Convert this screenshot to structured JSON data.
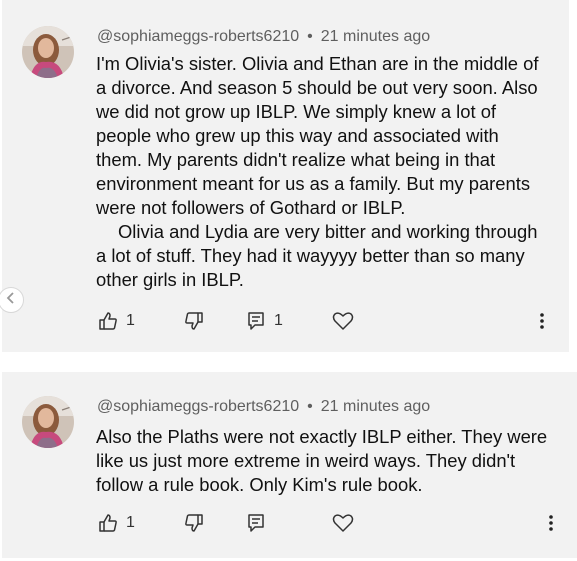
{
  "comments": [
    {
      "username": "@sophiameggs-roberts6210",
      "separator": "•",
      "timestamp": "21 minutes ago",
      "paragraphs": [
        "I'm Olivia's sister. Olivia and Ethan are in the middle of a divorce. And season 5 should be out very soon. Also we did not grow up IBLP. We simply knew a lot of people who grew up this way and associated with them. My parents didn't realize what being in that environment meant for us as a family. But my parents were not followers of Gothard or IBLP.",
        "Olivia and Lydia are very bitter and working through a lot of stuff. They had it wayyyy better than so many other girls in IBLP."
      ],
      "like_count": "1",
      "reply_count": "1"
    },
    {
      "username": "@sophiameggs-roberts6210",
      "separator": "•",
      "timestamp": "21 minutes ago",
      "paragraphs": [
        "Also the Plaths were not exactly IBLP either. They were like us just more extreme in weird ways. They didn't follow a rule book. Only Kim's rule book."
      ],
      "like_count": "1"
    }
  ],
  "icons": {
    "like": "thumb-up-icon",
    "dislike": "thumb-down-icon",
    "reply": "comment-icon",
    "heart": "heart-icon",
    "more": "more-vertical-icon",
    "scroll": "chevron-left-icon"
  },
  "colors": {
    "card_bg": "#f2f2f2",
    "meta_text": "#5f5f5f",
    "body_text": "#111111"
  }
}
